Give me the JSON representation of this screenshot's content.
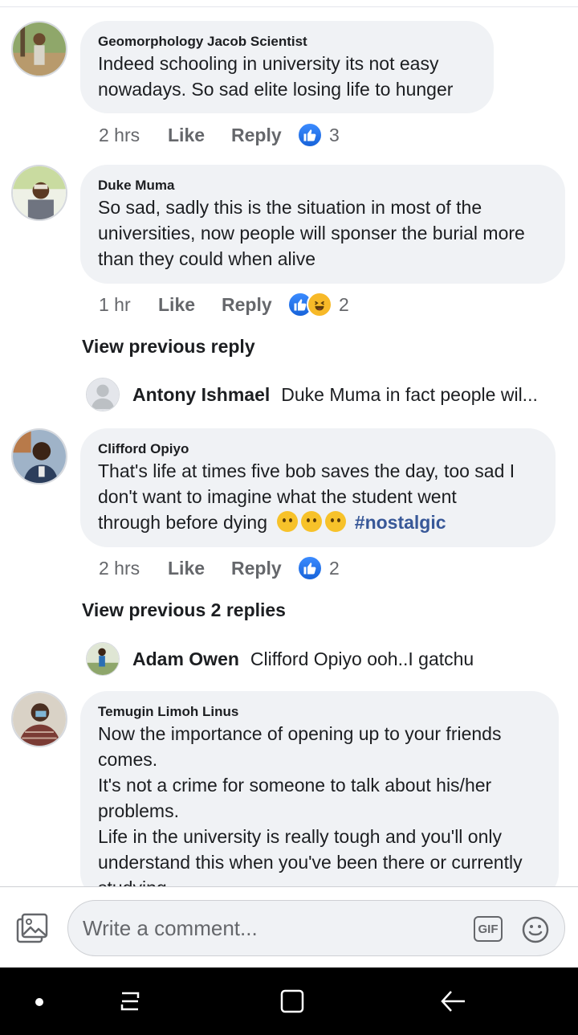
{
  "comments": [
    {
      "author": "Geomorphology Jacob Scientist",
      "lines": [
        "Indeed schooling in university its not easy",
        "nowadays. So sad elite losing life to hunger"
      ],
      "time": "2 hrs",
      "like_label": "Like",
      "reply_label": "Reply",
      "reaction_count": "3"
    },
    {
      "author": "Duke Muma",
      "lines": [
        "So sad, sadly this is the situation in most of the",
        "universities, now people will sponser the burial more",
        "than they could when alive"
      ],
      "time": "1 hr",
      "like_label": "Like",
      "reply_label": "Reply",
      "reaction_count": "2",
      "view_replies": "View previous reply",
      "reply": {
        "author": "Antony Ishmael",
        "text": "Duke Muma in fact people wil..."
      }
    },
    {
      "author": "Clifford Opiyo",
      "lines": [
        "That's life at times five bob saves the day, too sad I",
        "don't want to imagine what the student went",
        "through before dying"
      ],
      "hashtag": "#nostalgic",
      "time": "2 hrs",
      "like_label": "Like",
      "reply_label": "Reply",
      "reaction_count": "2",
      "view_replies": "View previous 2 replies",
      "reply": {
        "author": "Adam Owen",
        "text": "Clifford Opiyo ooh..I gatchu"
      }
    },
    {
      "author": "Temugin Limoh Linus",
      "lines": [
        "Now the importance of opening up to your friends",
        "comes.",
        "It's not a crime for someone to talk about his/her",
        "problems.",
        "Life in the university is really tough and you'll only",
        "understand this when you've been there or currently",
        "studying."
      ]
    }
  ],
  "composer": {
    "placeholder": "Write a comment...",
    "gif_label": "GIF"
  },
  "icons": {
    "photo": "photo-icon",
    "emoji": "smiley-icon",
    "like_reaction": "like-reaction-icon",
    "haha_reaction": "haha-reaction-icon"
  },
  "colors": {
    "bubble": "#f0f2f5",
    "like_blue": "#1877f2",
    "hashtag": "#385898",
    "meta_gray": "#65676b"
  }
}
